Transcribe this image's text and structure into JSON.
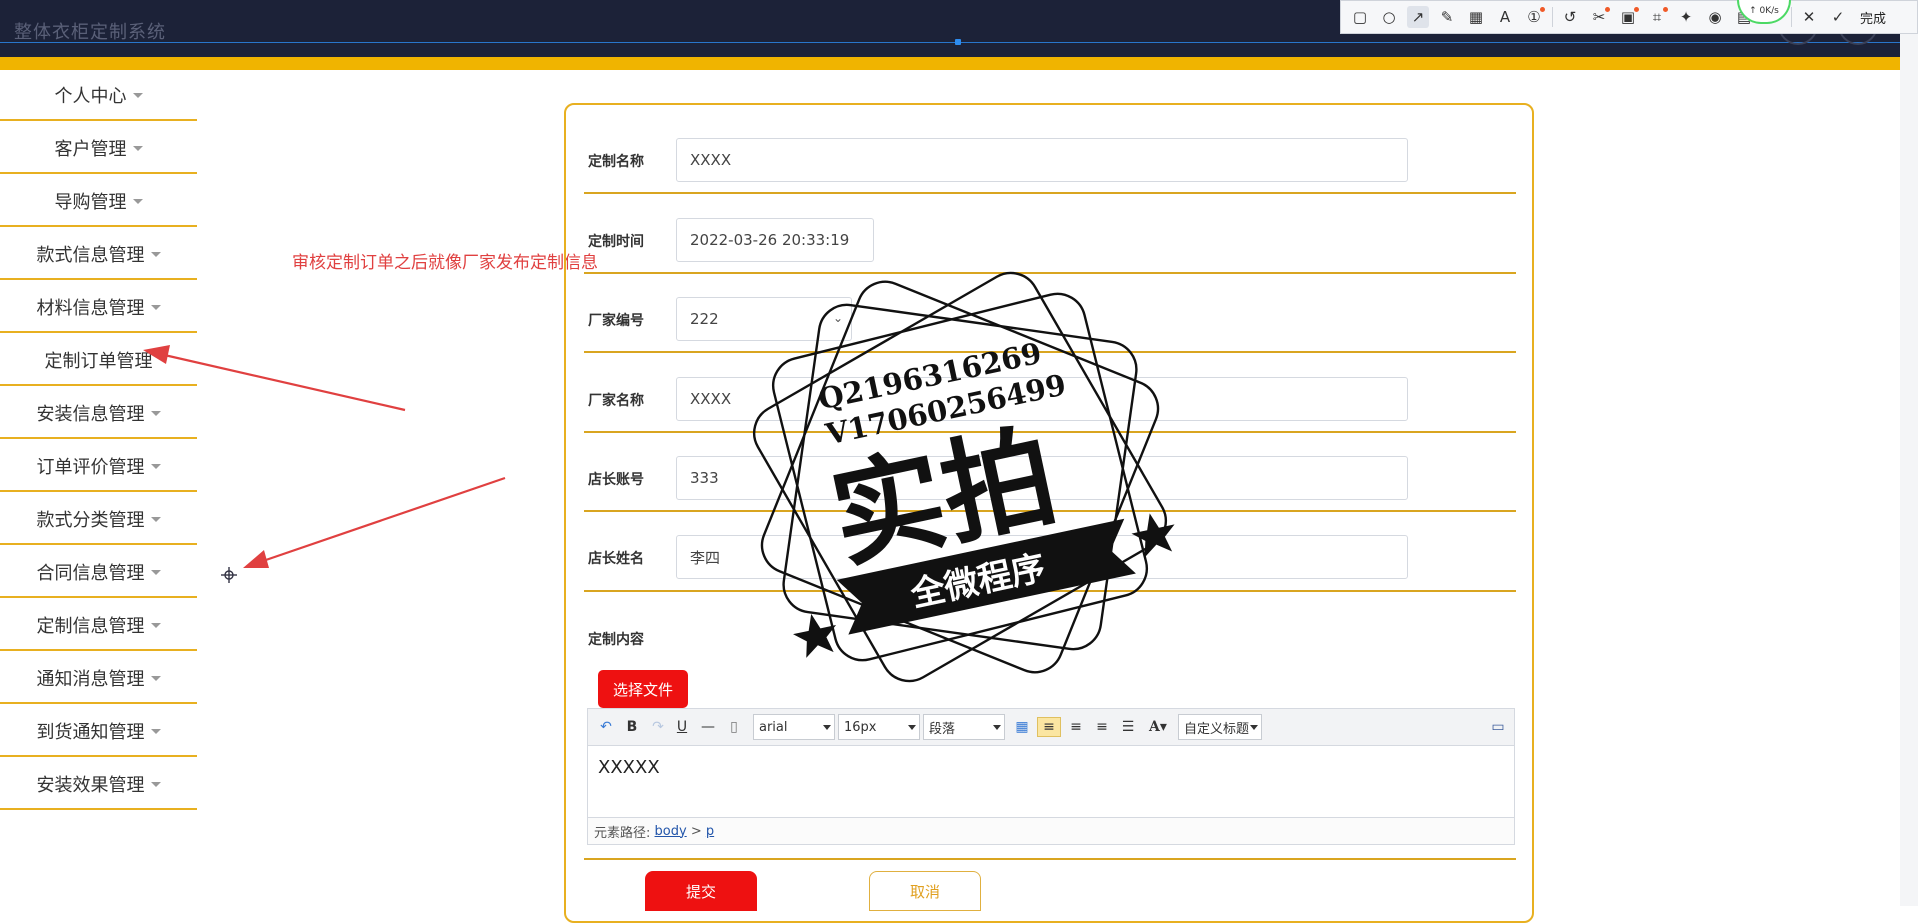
{
  "app": {
    "title": "整体衣柜定制系统"
  },
  "capture_toolbar": {
    "speed": "↑ 0K/s",
    "done_label": "完成"
  },
  "sidebar": {
    "items": [
      {
        "label": "个人中心"
      },
      {
        "label": "客户管理"
      },
      {
        "label": "导购管理"
      },
      {
        "label": "款式信息管理"
      },
      {
        "label": "材料信息管理"
      },
      {
        "label": "定制订单管理"
      },
      {
        "label": "安装信息管理"
      },
      {
        "label": "订单评价管理"
      },
      {
        "label": "款式分类管理"
      },
      {
        "label": "合同信息管理"
      },
      {
        "label": "定制信息管理"
      },
      {
        "label": "通知消息管理"
      },
      {
        "label": "到货通知管理"
      },
      {
        "label": "安装效果管理"
      }
    ]
  },
  "annotation": {
    "text": "审核定制订单之后就像厂家发布定制信息"
  },
  "form": {
    "fields": [
      {
        "label": "定制名称",
        "value": "XXXX"
      },
      {
        "label": "定制时间",
        "value": "2022-03-26 20:33:19"
      },
      {
        "label": "厂家编号",
        "value": "222"
      },
      {
        "label": "厂家名称",
        "value": "XXXX"
      },
      {
        "label": "店长账号",
        "value": "333"
      },
      {
        "label": "店长姓名",
        "value": "李四"
      }
    ],
    "content_label": "定制内容",
    "file_button": "选择文件",
    "submit_label": "提交",
    "cancel_label": "取消"
  },
  "editor": {
    "font_family": "arial",
    "font_size": "16px",
    "paragraph": "段落",
    "custom_title": "自定义标题",
    "content": "XXXXX",
    "path_label": "元素路径:",
    "path_body": "body",
    "path_sep": ">",
    "path_p": "p"
  },
  "watermark": {
    "line1": "Q2196316269",
    "line2": "V17060256499",
    "main": "实拍",
    "banner": "全微程序"
  }
}
